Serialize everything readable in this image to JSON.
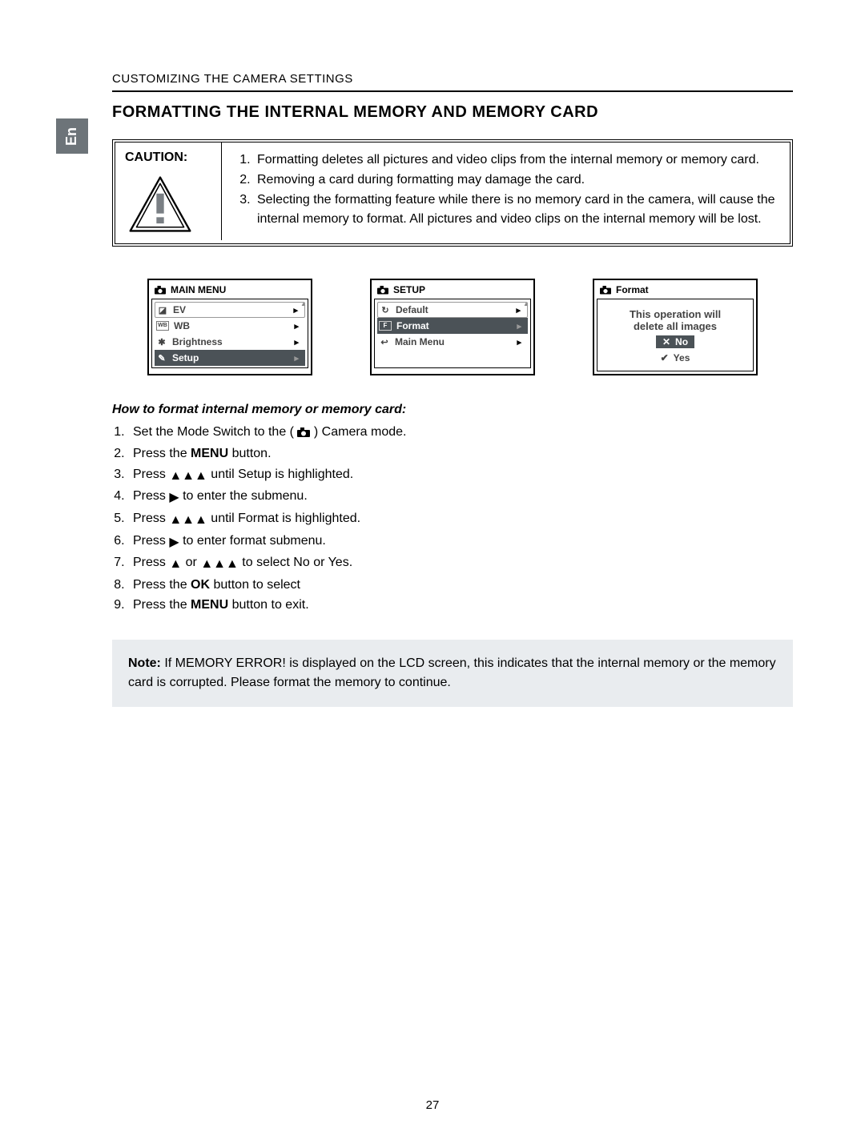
{
  "header": {
    "section": "CUSTOMIZING THE CAMERA SETTINGS"
  },
  "lang_tab": "En",
  "title": "FORMATTING THE INTERNAL MEMORY AND MEMORY CARD",
  "caution": {
    "label": "CAUTION:",
    "items": [
      "Formatting deletes all pictures and video clips from  the internal memory or memory card.",
      "Removing a card during formatting may damage  the card.",
      "Selecting the formatting feature while there is no memory card in the camera, will cause the internal memory to format.  All pictures and video clips on the internal memory will be lost."
    ]
  },
  "screens": {
    "main_menu": {
      "title": "MAIN MENU",
      "items": [
        "EV",
        "WB",
        "Brightness",
        "Setup"
      ],
      "selected_index": 3
    },
    "setup": {
      "title": "SETUP",
      "items": [
        "Default",
        "Format",
        "Main Menu"
      ],
      "selected_index": 1
    },
    "format": {
      "title": "Format",
      "line1": "This operation will",
      "line2": "delete all images",
      "options": [
        "No",
        "Yes"
      ],
      "selected_index": 0
    }
  },
  "howto": {
    "title": "How to format internal memory or memory card:",
    "steps": {
      "s1a": "Set the Mode Switch to the ( ",
      "s1b": " ) Camera mode.",
      "s2a": "Press the ",
      "s2b": "MENU",
      "s2c": " button.",
      "s3a": "Press  ",
      "s3b": " until Setup is highlighted.",
      "s4a": "Press  ",
      "s4b": " to enter the submenu.",
      "s5a": "Press  ",
      "s5b": " until Format is highlighted.",
      "s6a": "Press  ",
      "s6b": " to enter format submenu.",
      "s7a": "Press  ",
      "s7or": " or  ",
      "s7b": " to select No or Yes.",
      "s8a": "Press the ",
      "s8b": "OK",
      "s8c": " button to select",
      "s9a": "Press the ",
      "s9b": "MENU",
      "s9c": " button to exit."
    }
  },
  "note": {
    "label": "Note:",
    "text": " If MEMORY ERROR! is displayed on the LCD screen, this indicates that the internal memory or the memory card is corrupted. Please format the memory to continue."
  },
  "page_number": "27"
}
